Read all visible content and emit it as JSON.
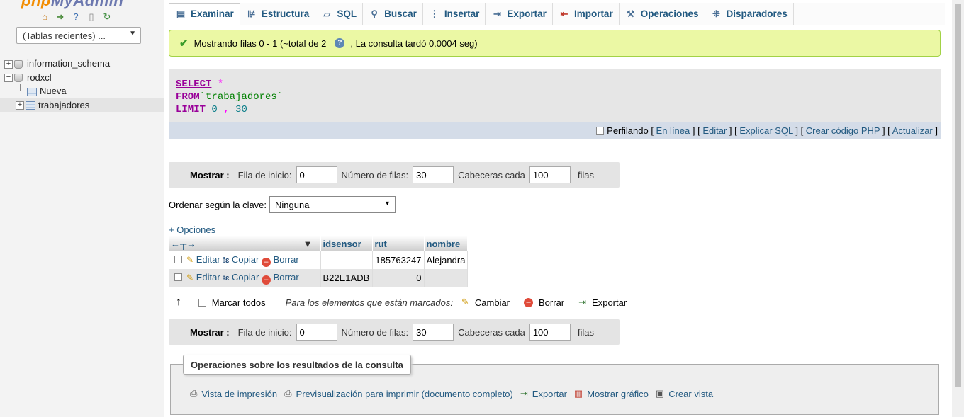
{
  "nav": {
    "logo_part1": "php",
    "logo_part2": "MyAdmin",
    "recent_tables": "(Tablas recientes) ...",
    "tree": [
      {
        "label": "information_schema"
      },
      {
        "label": "rodxcl"
      },
      {
        "label": "Nueva"
      },
      {
        "label": "trabajadores"
      }
    ]
  },
  "tabs": [
    {
      "label": "Examinar",
      "icon": "browse-icon"
    },
    {
      "label": "Estructura",
      "icon": "structure-icon"
    },
    {
      "label": "SQL",
      "icon": "sql-icon"
    },
    {
      "label": "Buscar",
      "icon": "search-icon"
    },
    {
      "label": "Insertar",
      "icon": "insert-icon"
    },
    {
      "label": "Exportar",
      "icon": "export-icon"
    },
    {
      "label": "Importar",
      "icon": "import-icon"
    },
    {
      "label": "Operaciones",
      "icon": "wrench-icon"
    },
    {
      "label": "Disparadores",
      "icon": "triggers-icon"
    }
  ],
  "message": {
    "text1": "Mostrando filas 0 - 1 (~total de 2",
    "text2": ", La consulta tardó 0.0004 seg)"
  },
  "sql": {
    "select": "SELECT",
    "star": "*",
    "from": "FROM",
    "table": "`trabajadores`",
    "limit": "LIMIT",
    "offset": "0",
    "comma": ",",
    "count": "30"
  },
  "sqlbar": {
    "profiling": "Perfilando",
    "inline": "En línea",
    "edit": "Editar",
    "explain": "Explicar SQL",
    "php": "Crear código PHP",
    "refresh": "Actualizar"
  },
  "navigation": {
    "show": "Mostrar :",
    "start_label": "Fila de inicio:",
    "start_value": "0",
    "rows_label": "Número de filas:",
    "rows_value": "30",
    "headers_label": "Cabeceras cada",
    "headers_value": "100",
    "rows_suffix": "filas"
  },
  "order": {
    "label": "Ordenar según la clave:",
    "value": "Ninguna"
  },
  "options_link": "+ Opciones",
  "table": {
    "columns": [
      "idsensor",
      "rut",
      "nombre"
    ],
    "actions": {
      "edit": "Editar",
      "copy": "Copiar",
      "delete": "Borrar"
    },
    "rows": [
      {
        "idsensor": "",
        "rut": "185763247",
        "nombre": "Alejandra"
      },
      {
        "idsensor": "B22E1ADB",
        "rut": "0",
        "nombre": ""
      }
    ]
  },
  "bulk": {
    "check_all": "Marcar todos",
    "with_selected": "Para los elementos que están marcados:",
    "change": "Cambiar",
    "delete": "Borrar",
    "export": "Exportar"
  },
  "query_ops": {
    "legend": "Operaciones sobre los resultados de la consulta",
    "print": "Vista de impresión",
    "print_full": "Previsualización para imprimir (documento completo)",
    "export": "Exportar",
    "chart": "Mostrar gráfico",
    "view": "Crear vista"
  }
}
